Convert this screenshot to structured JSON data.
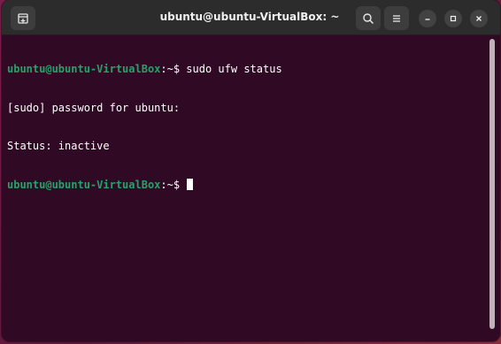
{
  "window": {
    "title": "ubuntu@ubuntu-VirtualBox: ~"
  },
  "titlebar": {
    "icons": {
      "new_tab": "new-tab-icon",
      "search": "search-icon",
      "menu": "hamburger-menu-icon",
      "minimize": "minimize-icon",
      "maximize": "maximize-icon",
      "close": "close-icon"
    }
  },
  "terminal": {
    "lines": [
      {
        "prompt_user": "ubuntu@ubuntu-VirtualBox",
        "prompt_symbol": ":~$ ",
        "text": "sudo ufw status"
      },
      {
        "text": "[sudo] password for ubuntu:"
      },
      {
        "text": "Status: inactive"
      },
      {
        "prompt_user": "ubuntu@ubuntu-VirtualBox",
        "prompt_symbol": ":~$ ",
        "text": ""
      }
    ]
  },
  "colors": {
    "terminal_bg": "#300a24",
    "prompt_user": "#26a269",
    "text": "#ffffff",
    "titlebar": "#2c2c2c"
  }
}
